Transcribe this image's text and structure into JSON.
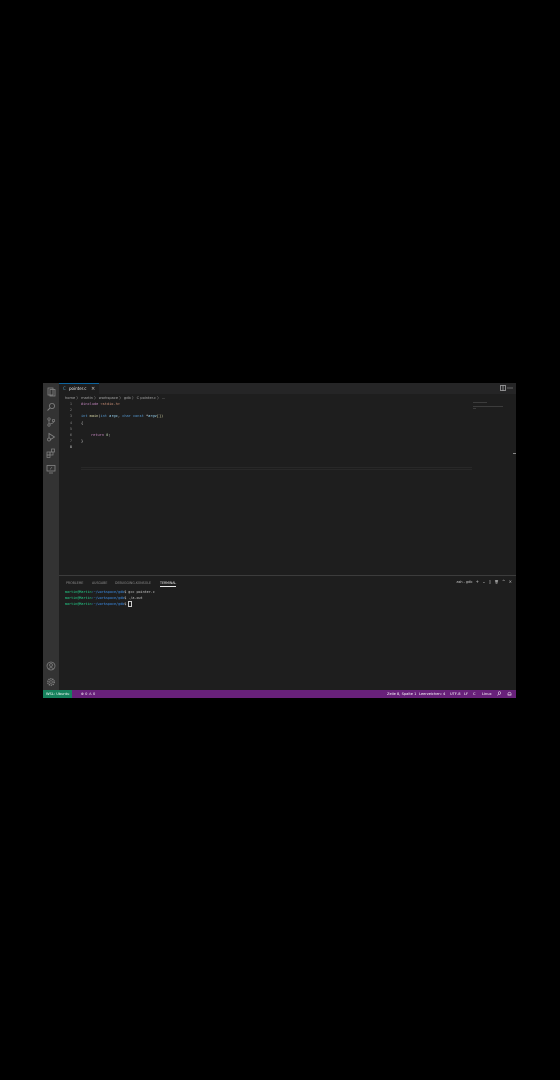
{
  "editor_tab": {
    "lang_icon": "C",
    "filename": "pointer.c",
    "close": "×"
  },
  "breadcrumb": "home 〉 martin 〉 workspace 〉 gdb 〉 C pointer.c 〉 ...",
  "code": {
    "line_numbers": [
      "1",
      "2",
      "3",
      "4",
      "5",
      "6",
      "7",
      "8"
    ],
    "l1_dir": "#include",
    "l1_hdr": " <stdio.h>",
    "l3_int": "int",
    "l3_main": " main",
    "l3_open": "(",
    "l3_int2": "int",
    "l3_argc": " argc",
    "l3_comma": ", ",
    "l3_char": "char",
    "l3_const": " const",
    "l3_star": " *",
    "l3_argv": "argv",
    "l3_close": "[])",
    "l4": "{",
    "l6_ret": "return",
    "l6_num": " 0",
    "l6_semi": ";",
    "l7": "}"
  },
  "panel": {
    "tabs": [
      "PROBLEME",
      "AUSGABE",
      "DEBUGGING-KONSOLE",
      "TERMINAL"
    ],
    "terminal_name": "ash - gdb",
    "tool_icons": [
      "+",
      "⌄",
      "▯",
      "🗑",
      "^",
      "×"
    ]
  },
  "terminal": {
    "prompt_user": "martin@Martin",
    "prompt_path": ":~/workspace/gdb",
    "prompt_symbol": "$",
    "cmd1": " gcc pointer.c",
    "cmd2": " ./a.out"
  },
  "status": {
    "remote": "WSL: Ubuntu",
    "problems": "⊗ 0  ⚠ 0",
    "position": "Zeile 8, Spalte 1",
    "spaces": "Leerzeichen: 4",
    "encoding": "UTF-8",
    "eol": "LF",
    "lang": "C",
    "os": "Linux"
  },
  "colors": {
    "status_bar": "#68217a",
    "remote": "#16825d",
    "editor_bg": "#1e1e1e",
    "activity_bar": "#333333"
  }
}
